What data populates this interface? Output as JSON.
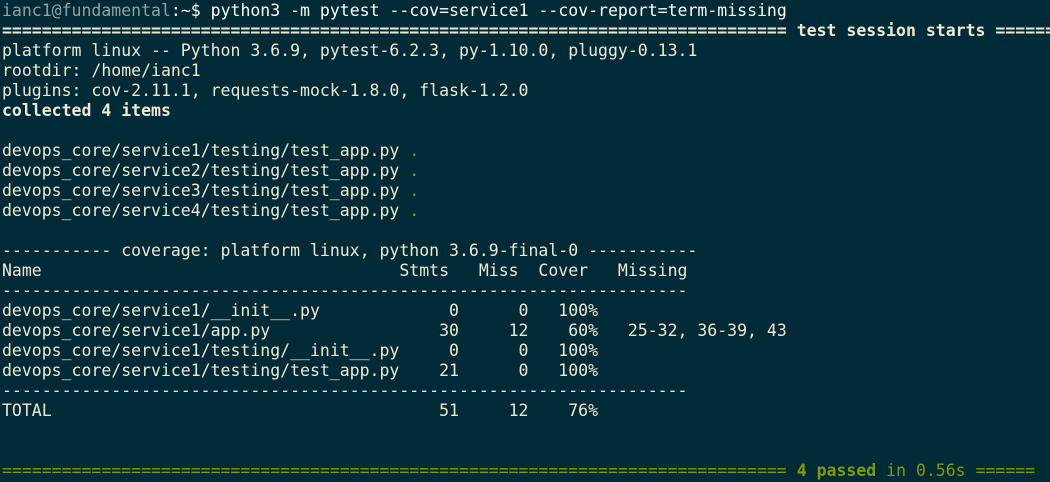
{
  "prompt": {
    "user_host": "ianc1@fundamental",
    "path": ":~$ ",
    "command": "python3 -m pytest --cov=service1 --cov-report=term-missing"
  },
  "header": {
    "sep_left": "===============================================================================",
    "title": " test session starts ",
    "sep_right": "======"
  },
  "platform": "platform linux -- Python 3.6.9, pytest-6.2.3, py-1.10.0, pluggy-0.13.1",
  "rootdir": "rootdir: /home/ianc1",
  "plugins": "plugins: cov-2.11.1, requests-mock-1.8.0, flask-1.2.0",
  "collected": "collected 4 items",
  "test_files": [
    {
      "path": "devops_core/service1/testing/test_app.py ",
      "result": "."
    },
    {
      "path": "devops_core/service2/testing/test_app.py ",
      "result": "."
    },
    {
      "path": "devops_core/service3/testing/test_app.py ",
      "result": "."
    },
    {
      "path": "devops_core/service4/testing/test_app.py ",
      "result": "."
    }
  ],
  "coverage": {
    "banner": "----------- coverage: platform linux, python 3.6.9-final-0 -----------",
    "header": "Name                                    Stmts   Miss  Cover   Missing",
    "divider": "---------------------------------------------------------------------",
    "rows": [
      "devops_core/service1/__init__.py             0      0   100%",
      "devops_core/service1/app.py                 30     12    60%   25-32, 36-39, 43",
      "devops_core/service1/testing/__init__.py     0      0   100%",
      "devops_core/service1/testing/test_app.py    21      0   100%"
    ],
    "total": "TOTAL                                       51     12    76%"
  },
  "summary": {
    "sep_left": "=============================================================================== ",
    "passed": "4 passed",
    "in_time": " in 0.56s",
    "sep_right": " ======"
  },
  "colors": {
    "background": "#002b36",
    "foreground": "#eee8d5",
    "green": "#859900",
    "yellow": "#b58900"
  }
}
